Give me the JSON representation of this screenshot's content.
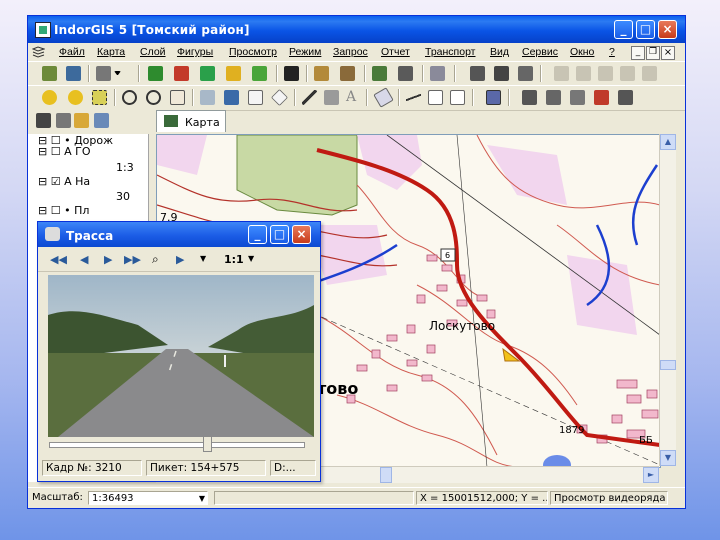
{
  "window": {
    "title": "IndorGIS 5   [Томский район]",
    "controls": {
      "minimize": "_",
      "maximize": "□",
      "close": "×"
    }
  },
  "menu": {
    "items": [
      "Файл",
      "Карта",
      "Слой",
      "Фигуры",
      "Просмотр",
      "Режим",
      "Запрос",
      "Отчет",
      "Транспорт",
      "Вид",
      "Сервис",
      "Окно",
      "?"
    ]
  },
  "doc_controls": {
    "minimize": "_",
    "restore": "❐",
    "close": "×"
  },
  "left_panel": {
    "tree": [
      {
        "prefix": "⊟ ☐ •",
        "label": "Дорож"
      },
      {
        "prefix": "⊟ ☐ A",
        "label": "ГО"
      },
      {
        "prefix": "",
        "label": "1:3"
      },
      {
        "prefix": "⊟ ☑ A",
        "label": "На"
      },
      {
        "prefix": "",
        "label": "30"
      },
      {
        "prefix": "⊟ ☐ •",
        "label": "Пл"
      }
    ]
  },
  "map_tab": {
    "label": "Карта"
  },
  "map": {
    "labels": {
      "village_small": "Лоскутово",
      "village_bold": "тово",
      "grid_79": "7.9",
      "grid_1879": "1879",
      "edge_label": "ББ",
      "road_marker": "6"
    }
  },
  "statusbar": {
    "scale_label": "Масштаб:",
    "scale_value": "1:36493",
    "coords": "X = 15001512,000; Y = ...",
    "mode": "Просмотр видеоряда"
  },
  "subwindow": {
    "title": "Трасса",
    "zoom": "1:1",
    "frame": "Кадр №: 3210",
    "picket": "Пикет:  154+575",
    "disk": "D:...",
    "slider_position": 0.62
  },
  "colors": {
    "title_bar": "#0a54e6",
    "track_road": "#c01a12",
    "water": "#1c3fcf",
    "contour": "#b4322a",
    "forest": "#c8d9a4",
    "building": "#f2b8cc"
  }
}
